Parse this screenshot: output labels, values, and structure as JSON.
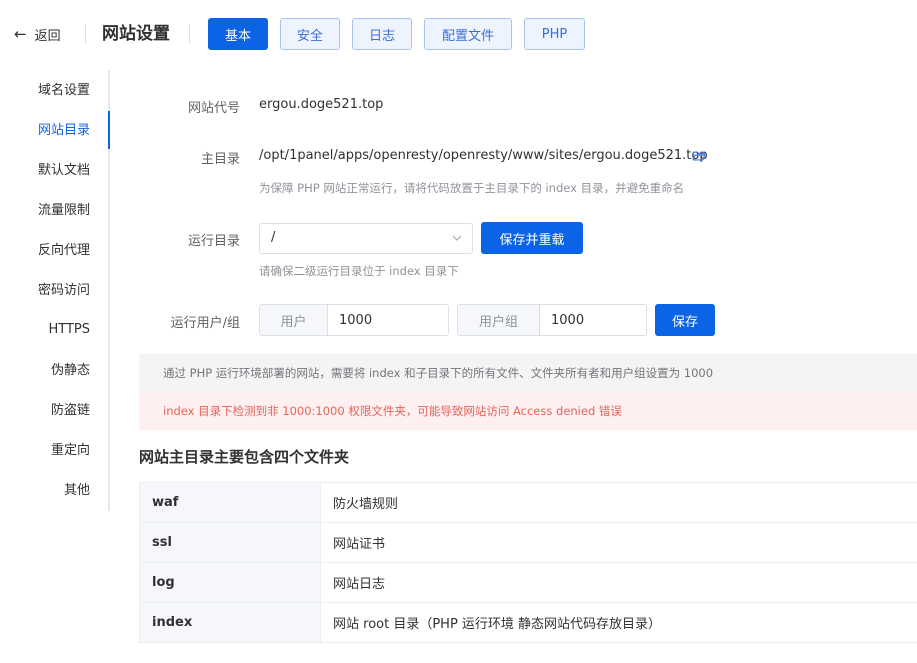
{
  "header": {
    "back_label": "返回",
    "title": "网站设置",
    "tabs": [
      {
        "label": "基本",
        "active": true
      },
      {
        "label": "安全",
        "active": false
      },
      {
        "label": "日志",
        "active": false
      },
      {
        "label": "配置文件",
        "active": false
      },
      {
        "label": "PHP",
        "active": false
      }
    ]
  },
  "sidebar": {
    "items": [
      {
        "label": "域名设置",
        "active": false
      },
      {
        "label": "网站目录",
        "active": true
      },
      {
        "label": "默认文档",
        "active": false
      },
      {
        "label": "流量限制",
        "active": false
      },
      {
        "label": "反向代理",
        "active": false
      },
      {
        "label": "密码访问",
        "active": false
      },
      {
        "label": "HTTPS",
        "active": false
      },
      {
        "label": "伪静态",
        "active": false
      },
      {
        "label": "防盗链",
        "active": false
      },
      {
        "label": "重定向",
        "active": false
      },
      {
        "label": "其他",
        "active": false
      }
    ]
  },
  "form": {
    "site_code_label": "网站代号",
    "site_code_value": "ergou.doge521.top",
    "root_dir_label": "主目录",
    "root_dir_value": "/opt/1panel/apps/openresty/openresty/www/sites/ergou.doge521.top",
    "root_dir_hint": "为保障 PHP 网站正常运行，请将代码放置于主目录下的 index 目录，并避免重命名",
    "run_dir_label": "运行目录",
    "run_dir_value": "/",
    "save_reload_label": "保存并重载",
    "run_dir_hint": "请确保二级运行目录位于 index 目录下",
    "run_user_label": "运行用户/组",
    "user_prefix": "用户",
    "user_value": "1000",
    "group_prefix": "用户组",
    "group_value": "1000",
    "save_label": "保存"
  },
  "alerts": {
    "info": "通过 PHP 运行环境部署的网站，需要将 index 和子目录下的所有文件、文件夹所有者和用户组设置为 1000",
    "error": "index 目录下检测到非 1000:1000 权限文件夹，可能导致网站访问 Access denied 错误"
  },
  "folders": {
    "title": "网站主目录主要包含四个文件夹",
    "rows": [
      {
        "name": "waf",
        "desc": "防火墙规则"
      },
      {
        "name": "ssl",
        "desc": "网站证书"
      },
      {
        "name": "log",
        "desc": "网站日志"
      },
      {
        "name": "index",
        "desc": "网站 root 目录（PHP 运行环境 静态网站代码存放目录）"
      }
    ]
  },
  "colors": {
    "primary": "#0b63e5",
    "error_bg": "#fef0f0",
    "error_text": "#e5645a",
    "info_bg": "#f4f4f5"
  },
  "icons": {
    "back": "arrow-left-icon",
    "folder": "folder-open-icon",
    "select": "chevron-down-icon"
  }
}
